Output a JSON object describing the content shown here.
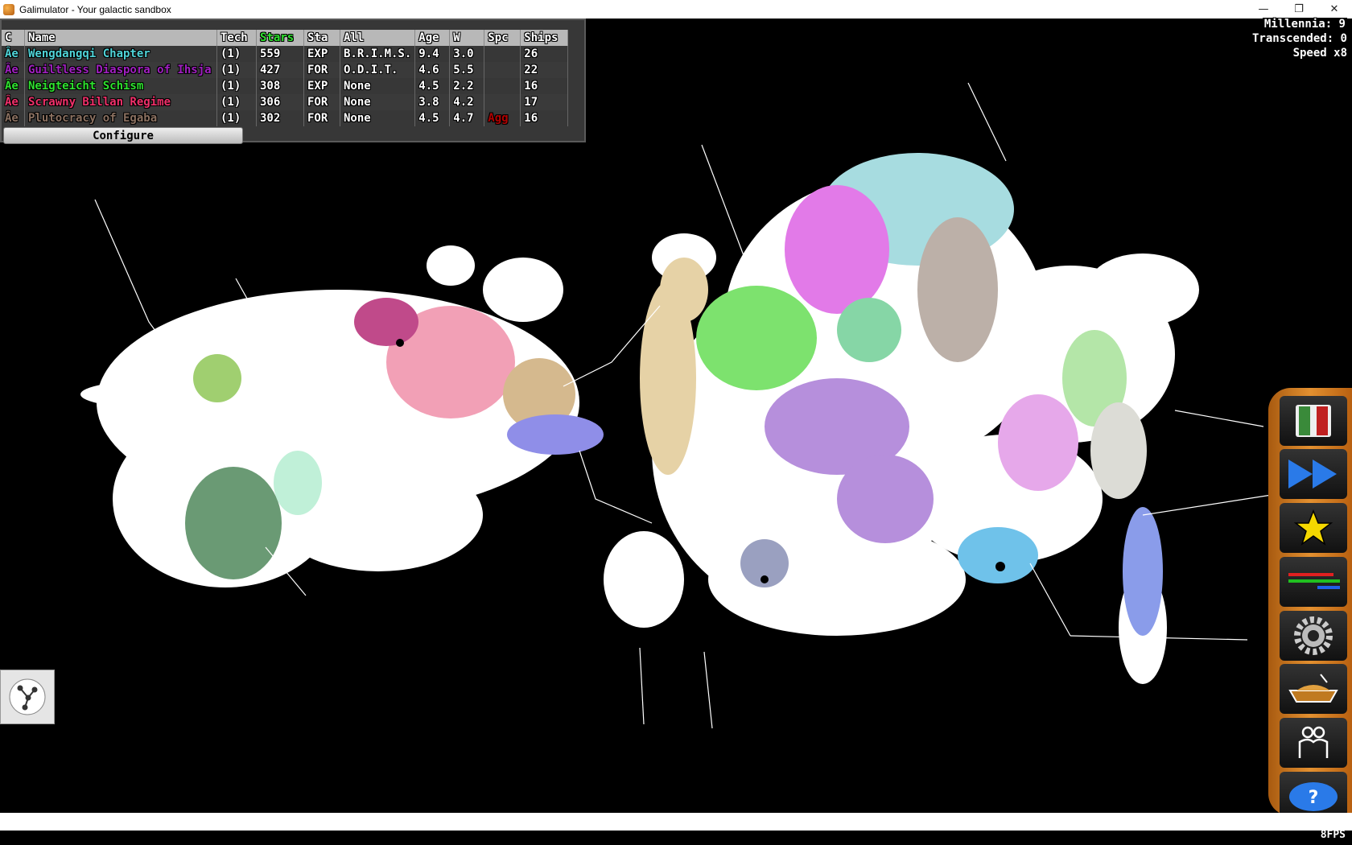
{
  "window": {
    "title": "Galimulator - Your galactic sandbox",
    "minimize": "—",
    "restore": "❐",
    "close": "✕"
  },
  "hud": {
    "millennia": "Millennia: 9",
    "transcended": "Transcended: 0",
    "speed": "Speed x8",
    "fps": "8FPS"
  },
  "table": {
    "headers": [
      "C",
      "Name",
      "Tech",
      "Stars",
      "Sta",
      "All",
      "Age",
      "W",
      "Spc",
      "Ships"
    ],
    "rows": [
      {
        "c": "Âe",
        "name": "Wengdangqi Chapter",
        "tech": "(1)",
        "stars": "559",
        "sta": "EXP",
        "all": "B.R.I.M.S.",
        "age": "9.4",
        "w": "3.0",
        "spc": "",
        "ships": "26",
        "color": "#4fd3d7"
      },
      {
        "c": "Âe",
        "name": "Guiltless Diaspora of Ihsja",
        "tech": "(1)",
        "stars": "427",
        "sta": "FOR",
        "all": "O.D.I.T.",
        "age": "4.6",
        "w": "5.5",
        "spc": "",
        "ships": "22",
        "color": "#a020c0"
      },
      {
        "c": "Âe",
        "name": "Neigteicht Schism",
        "tech": "(1)",
        "stars": "308",
        "sta": "EXP",
        "all": "None",
        "age": "4.5",
        "w": "2.2",
        "spc": "",
        "ships": "16",
        "color": "#2ee02e"
      },
      {
        "c": "Âe",
        "name": "Scrawny Billan Regime",
        "tech": "(1)",
        "stars": "306",
        "sta": "FOR",
        "all": "None",
        "age": "3.8",
        "w": "4.2",
        "spc": "",
        "ships": "17",
        "color": "#f0306a"
      },
      {
        "c": "Âe",
        "name": "Plutocracy of Egaba",
        "tech": "(1)",
        "stars": "302",
        "sta": "FOR",
        "all": "None",
        "age": "4.5",
        "w": "4.7",
        "spc": "Agg",
        "ships": "16",
        "color": "#8a7060"
      }
    ],
    "configure": "Configure"
  },
  "sidebar": {
    "buttons": [
      {
        "name": "empires-book-button",
        "icon": "book-icon"
      },
      {
        "name": "fast-forward-button",
        "icon": "fast-forward-icon"
      },
      {
        "name": "star-button",
        "icon": "star-icon"
      },
      {
        "name": "stats-button",
        "icon": "bars-icon"
      },
      {
        "name": "settings-button",
        "icon": "gear-icon"
      },
      {
        "name": "disaster-button",
        "icon": "rubble-icon"
      },
      {
        "name": "people-button",
        "icon": "people-icon"
      },
      {
        "name": "help-button",
        "icon": "help-icon"
      }
    ]
  },
  "colors": {
    "accent": "#e39030",
    "stars_header": "#2ee02e",
    "agg": "#b00000"
  }
}
